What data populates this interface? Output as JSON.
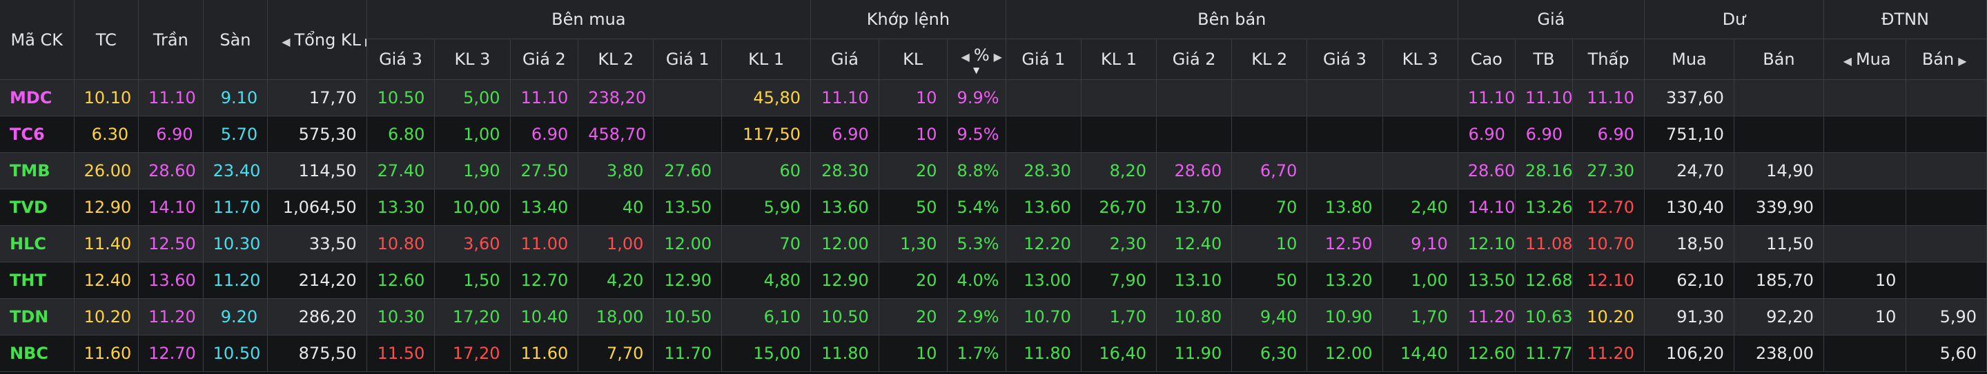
{
  "colors": {
    "ref": "#ffd33d",
    "ceil": "#ee5bf2",
    "floor": "#45dff0",
    "up": "#45e14c",
    "down": "#ff4d4d",
    "neutral": "#e8e8e8"
  },
  "headers": {
    "symbol": "Mã CK",
    "ref": "TC",
    "ceil": "Trần",
    "floor": "Sàn",
    "total_vol": "Tổng KL",
    "buy_group": "Bên mua",
    "match_group": "Khớp lệnh",
    "sell_group": "Bên bán",
    "price_group": "Giá",
    "remain_group": "Dư",
    "foreign_group": "ĐTNN",
    "buy_cols": [
      "Giá 3",
      "KL 3",
      "Giá 2",
      "KL 2",
      "Giá 1",
      "KL 1"
    ],
    "match_cols": [
      "Giá",
      "KL",
      "%"
    ],
    "sell_cols": [
      "Giá 1",
      "KL 1",
      "Giá 2",
      "KL 2",
      "Giá 3",
      "KL 3"
    ],
    "price_cols": [
      "Cao",
      "TB",
      "Thấp"
    ],
    "remain_cols": [
      "Mua",
      "Bán"
    ],
    "foreign_cols": [
      "Mua",
      "Bán"
    ]
  },
  "rows": [
    {
      "symbol": {
        "t": "MDC",
        "c": "ceil"
      },
      "ref": {
        "t": "10.10",
        "c": "ref"
      },
      "ceil": {
        "t": "11.10",
        "c": "ceil"
      },
      "floor": {
        "t": "9.10",
        "c": "floor"
      },
      "total": {
        "t": "17,70",
        "c": "neutral"
      },
      "buy": [
        {
          "t": "10.50",
          "c": "up"
        },
        {
          "t": "5,00",
          "c": "up"
        },
        {
          "t": "11.10",
          "c": "ceil"
        },
        {
          "t": "238,20",
          "c": "ceil"
        },
        {
          "t": "",
          "c": "neutral"
        },
        {
          "t": "45,80",
          "c": "ref"
        }
      ],
      "match": [
        {
          "t": "11.10",
          "c": "ceil"
        },
        {
          "t": "10",
          "c": "ceil"
        },
        {
          "t": "9.9%",
          "c": "ceil"
        }
      ],
      "sell": [
        {
          "t": "",
          "c": "neutral"
        },
        {
          "t": "",
          "c": "neutral"
        },
        {
          "t": "",
          "c": "neutral"
        },
        {
          "t": "",
          "c": "neutral"
        },
        {
          "t": "",
          "c": "neutral"
        },
        {
          "t": "",
          "c": "neutral"
        }
      ],
      "price": [
        {
          "t": "11.10",
          "c": "ceil"
        },
        {
          "t": "11.10",
          "c": "ceil"
        },
        {
          "t": "11.10",
          "c": "ceil"
        }
      ],
      "remain": [
        {
          "t": "337,60",
          "c": "neutral"
        },
        {
          "t": "",
          "c": "neutral"
        }
      ],
      "foreign": [
        {
          "t": "",
          "c": "neutral"
        },
        {
          "t": "",
          "c": "neutral"
        }
      ]
    },
    {
      "symbol": {
        "t": "TC6",
        "c": "ceil"
      },
      "ref": {
        "t": "6.30",
        "c": "ref"
      },
      "ceil": {
        "t": "6.90",
        "c": "ceil"
      },
      "floor": {
        "t": "5.70",
        "c": "floor"
      },
      "total": {
        "t": "575,30",
        "c": "neutral"
      },
      "buy": [
        {
          "t": "6.80",
          "c": "up"
        },
        {
          "t": "1,00",
          "c": "up"
        },
        {
          "t": "6.90",
          "c": "ceil"
        },
        {
          "t": "458,70",
          "c": "ceil"
        },
        {
          "t": "",
          "c": "neutral"
        },
        {
          "t": "117,50",
          "c": "ref"
        }
      ],
      "match": [
        {
          "t": "6.90",
          "c": "ceil"
        },
        {
          "t": "10",
          "c": "ceil"
        },
        {
          "t": "9.5%",
          "c": "ceil"
        }
      ],
      "sell": [
        {
          "t": "",
          "c": "neutral"
        },
        {
          "t": "",
          "c": "neutral"
        },
        {
          "t": "",
          "c": "neutral"
        },
        {
          "t": "",
          "c": "neutral"
        },
        {
          "t": "",
          "c": "neutral"
        },
        {
          "t": "",
          "c": "neutral"
        }
      ],
      "price": [
        {
          "t": "6.90",
          "c": "ceil"
        },
        {
          "t": "6.90",
          "c": "ceil"
        },
        {
          "t": "6.90",
          "c": "ceil"
        }
      ],
      "remain": [
        {
          "t": "751,10",
          "c": "neutral"
        },
        {
          "t": "",
          "c": "neutral"
        }
      ],
      "foreign": [
        {
          "t": "",
          "c": "neutral"
        },
        {
          "t": "",
          "c": "neutral"
        }
      ]
    },
    {
      "symbol": {
        "t": "TMB",
        "c": "up"
      },
      "ref": {
        "t": "26.00",
        "c": "ref"
      },
      "ceil": {
        "t": "28.60",
        "c": "ceil"
      },
      "floor": {
        "t": "23.40",
        "c": "floor"
      },
      "total": {
        "t": "114,50",
        "c": "neutral"
      },
      "buy": [
        {
          "t": "27.40",
          "c": "up"
        },
        {
          "t": "1,90",
          "c": "up"
        },
        {
          "t": "27.50",
          "c": "up"
        },
        {
          "t": "3,80",
          "c": "up"
        },
        {
          "t": "27.60",
          "c": "up"
        },
        {
          "t": "60",
          "c": "up"
        }
      ],
      "match": [
        {
          "t": "28.30",
          "c": "up"
        },
        {
          "t": "20",
          "c": "up"
        },
        {
          "t": "8.8%",
          "c": "up"
        }
      ],
      "sell": [
        {
          "t": "28.30",
          "c": "up"
        },
        {
          "t": "8,20",
          "c": "up"
        },
        {
          "t": "28.60",
          "c": "ceil"
        },
        {
          "t": "6,70",
          "c": "ceil"
        },
        {
          "t": "",
          "c": "neutral"
        },
        {
          "t": "",
          "c": "neutral"
        }
      ],
      "price": [
        {
          "t": "28.60",
          "c": "ceil"
        },
        {
          "t": "28.16",
          "c": "up"
        },
        {
          "t": "27.30",
          "c": "up"
        }
      ],
      "remain": [
        {
          "t": "24,70",
          "c": "neutral"
        },
        {
          "t": "14,90",
          "c": "neutral"
        }
      ],
      "foreign": [
        {
          "t": "",
          "c": "neutral"
        },
        {
          "t": "",
          "c": "neutral"
        }
      ]
    },
    {
      "symbol": {
        "t": "TVD",
        "c": "up"
      },
      "ref": {
        "t": "12.90",
        "c": "ref"
      },
      "ceil": {
        "t": "14.10",
        "c": "ceil"
      },
      "floor": {
        "t": "11.70",
        "c": "floor"
      },
      "total": {
        "t": "1,064,50",
        "c": "neutral"
      },
      "buy": [
        {
          "t": "13.30",
          "c": "up"
        },
        {
          "t": "10,00",
          "c": "up"
        },
        {
          "t": "13.40",
          "c": "up"
        },
        {
          "t": "40",
          "c": "up"
        },
        {
          "t": "13.50",
          "c": "up"
        },
        {
          "t": "5,90",
          "c": "up"
        }
      ],
      "match": [
        {
          "t": "13.60",
          "c": "up"
        },
        {
          "t": "50",
          "c": "up"
        },
        {
          "t": "5.4%",
          "c": "up"
        }
      ],
      "sell": [
        {
          "t": "13.60",
          "c": "up"
        },
        {
          "t": "26,70",
          "c": "up"
        },
        {
          "t": "13.70",
          "c": "up"
        },
        {
          "t": "70",
          "c": "up"
        },
        {
          "t": "13.80",
          "c": "up"
        },
        {
          "t": "2,40",
          "c": "up"
        }
      ],
      "price": [
        {
          "t": "14.10",
          "c": "ceil"
        },
        {
          "t": "13.26",
          "c": "up"
        },
        {
          "t": "12.70",
          "c": "down"
        }
      ],
      "remain": [
        {
          "t": "130,40",
          "c": "neutral"
        },
        {
          "t": "339,90",
          "c": "neutral"
        }
      ],
      "foreign": [
        {
          "t": "",
          "c": "neutral"
        },
        {
          "t": "",
          "c": "neutral"
        }
      ]
    },
    {
      "symbol": {
        "t": "HLC",
        "c": "up"
      },
      "ref": {
        "t": "11.40",
        "c": "ref"
      },
      "ceil": {
        "t": "12.50",
        "c": "ceil"
      },
      "floor": {
        "t": "10.30",
        "c": "floor"
      },
      "total": {
        "t": "33,50",
        "c": "neutral"
      },
      "buy": [
        {
          "t": "10.80",
          "c": "down"
        },
        {
          "t": "3,60",
          "c": "down"
        },
        {
          "t": "11.00",
          "c": "down"
        },
        {
          "t": "1,00",
          "c": "down"
        },
        {
          "t": "12.00",
          "c": "up"
        },
        {
          "t": "70",
          "c": "up"
        }
      ],
      "match": [
        {
          "t": "12.00",
          "c": "up"
        },
        {
          "t": "1,30",
          "c": "up"
        },
        {
          "t": "5.3%",
          "c": "up"
        }
      ],
      "sell": [
        {
          "t": "12.20",
          "c": "up"
        },
        {
          "t": "2,30",
          "c": "up"
        },
        {
          "t": "12.40",
          "c": "up"
        },
        {
          "t": "10",
          "c": "up"
        },
        {
          "t": "12.50",
          "c": "ceil"
        },
        {
          "t": "9,10",
          "c": "ceil"
        }
      ],
      "price": [
        {
          "t": "12.10",
          "c": "up"
        },
        {
          "t": "11.08",
          "c": "down"
        },
        {
          "t": "10.70",
          "c": "down"
        }
      ],
      "remain": [
        {
          "t": "18,50",
          "c": "neutral"
        },
        {
          "t": "11,50",
          "c": "neutral"
        }
      ],
      "foreign": [
        {
          "t": "",
          "c": "neutral"
        },
        {
          "t": "",
          "c": "neutral"
        }
      ]
    },
    {
      "symbol": {
        "t": "THT",
        "c": "up"
      },
      "ref": {
        "t": "12.40",
        "c": "ref"
      },
      "ceil": {
        "t": "13.60",
        "c": "ceil"
      },
      "floor": {
        "t": "11.20",
        "c": "floor"
      },
      "total": {
        "t": "214,20",
        "c": "neutral"
      },
      "buy": [
        {
          "t": "12.60",
          "c": "up"
        },
        {
          "t": "1,50",
          "c": "up"
        },
        {
          "t": "12.70",
          "c": "up"
        },
        {
          "t": "4,20",
          "c": "up"
        },
        {
          "t": "12.90",
          "c": "up"
        },
        {
          "t": "4,80",
          "c": "up"
        }
      ],
      "match": [
        {
          "t": "12.90",
          "c": "up"
        },
        {
          "t": "20",
          "c": "up"
        },
        {
          "t": "4.0%",
          "c": "up"
        }
      ],
      "sell": [
        {
          "t": "13.00",
          "c": "up"
        },
        {
          "t": "7,90",
          "c": "up"
        },
        {
          "t": "13.10",
          "c": "up"
        },
        {
          "t": "50",
          "c": "up"
        },
        {
          "t": "13.20",
          "c": "up"
        },
        {
          "t": "1,00",
          "c": "up"
        }
      ],
      "price": [
        {
          "t": "13.50",
          "c": "up"
        },
        {
          "t": "12.68",
          "c": "up"
        },
        {
          "t": "12.10",
          "c": "down"
        }
      ],
      "remain": [
        {
          "t": "62,10",
          "c": "neutral"
        },
        {
          "t": "185,70",
          "c": "neutral"
        }
      ],
      "foreign": [
        {
          "t": "10",
          "c": "neutral"
        },
        {
          "t": "",
          "c": "neutral"
        }
      ]
    },
    {
      "symbol": {
        "t": "TDN",
        "c": "up"
      },
      "ref": {
        "t": "10.20",
        "c": "ref"
      },
      "ceil": {
        "t": "11.20",
        "c": "ceil"
      },
      "floor": {
        "t": "9.20",
        "c": "floor"
      },
      "total": {
        "t": "286,20",
        "c": "neutral"
      },
      "buy": [
        {
          "t": "10.30",
          "c": "up"
        },
        {
          "t": "17,20",
          "c": "up"
        },
        {
          "t": "10.40",
          "c": "up"
        },
        {
          "t": "18,00",
          "c": "up"
        },
        {
          "t": "10.50",
          "c": "up"
        },
        {
          "t": "6,10",
          "c": "up"
        }
      ],
      "match": [
        {
          "t": "10.50",
          "c": "up"
        },
        {
          "t": "20",
          "c": "up"
        },
        {
          "t": "2.9%",
          "c": "up"
        }
      ],
      "sell": [
        {
          "t": "10.70",
          "c": "up"
        },
        {
          "t": "1,70",
          "c": "up"
        },
        {
          "t": "10.80",
          "c": "up"
        },
        {
          "t": "9,40",
          "c": "up"
        },
        {
          "t": "10.90",
          "c": "up"
        },
        {
          "t": "1,70",
          "c": "up"
        }
      ],
      "price": [
        {
          "t": "11.20",
          "c": "ceil"
        },
        {
          "t": "10.63",
          "c": "up"
        },
        {
          "t": "10.20",
          "c": "ref"
        }
      ],
      "remain": [
        {
          "t": "91,30",
          "c": "neutral"
        },
        {
          "t": "92,20",
          "c": "neutral"
        }
      ],
      "foreign": [
        {
          "t": "10",
          "c": "neutral"
        },
        {
          "t": "5,90",
          "c": "neutral"
        }
      ]
    },
    {
      "symbol": {
        "t": "NBC",
        "c": "up"
      },
      "ref": {
        "t": "11.60",
        "c": "ref"
      },
      "ceil": {
        "t": "12.70",
        "c": "ceil"
      },
      "floor": {
        "t": "10.50",
        "c": "floor"
      },
      "total": {
        "t": "875,50",
        "c": "neutral"
      },
      "buy": [
        {
          "t": "11.50",
          "c": "down"
        },
        {
          "t": "17,20",
          "c": "down"
        },
        {
          "t": "11.60",
          "c": "ref"
        },
        {
          "t": "7,70",
          "c": "ref"
        },
        {
          "t": "11.70",
          "c": "up"
        },
        {
          "t": "15,00",
          "c": "up"
        }
      ],
      "match": [
        {
          "t": "11.80",
          "c": "up"
        },
        {
          "t": "10",
          "c": "up"
        },
        {
          "t": "1.7%",
          "c": "up"
        }
      ],
      "sell": [
        {
          "t": "11.80",
          "c": "up"
        },
        {
          "t": "16,40",
          "c": "up"
        },
        {
          "t": "11.90",
          "c": "up"
        },
        {
          "t": "6,30",
          "c": "up"
        },
        {
          "t": "12.00",
          "c": "up"
        },
        {
          "t": "14,40",
          "c": "up"
        }
      ],
      "price": [
        {
          "t": "12.60",
          "c": "up"
        },
        {
          "t": "11.77",
          "c": "up"
        },
        {
          "t": "11.20",
          "c": "down"
        }
      ],
      "remain": [
        {
          "t": "106,20",
          "c": "neutral"
        },
        {
          "t": "238,00",
          "c": "neutral"
        }
      ],
      "foreign": [
        {
          "t": "",
          "c": "neutral"
        },
        {
          "t": "5,60",
          "c": "neutral"
        }
      ]
    }
  ]
}
